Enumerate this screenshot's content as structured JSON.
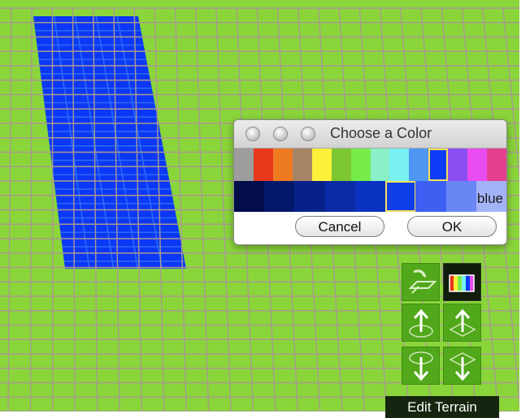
{
  "colors": {
    "terrain": "#8ad53a",
    "grid": "#a99a92",
    "painted_tiles": "#0c37f5",
    "tool_bg": "#50a81a",
    "tool_active_bg": "#121c0c",
    "label_bg": "#16250f"
  },
  "dialog": {
    "title": "Choose a Color",
    "window_buttons": [
      "close",
      "minimize",
      "zoom"
    ],
    "palette_hues": [
      {
        "name": "gray",
        "hex": "#9d9d9d"
      },
      {
        "name": "red",
        "hex": "#e8371b"
      },
      {
        "name": "orange",
        "hex": "#ee7a22"
      },
      {
        "name": "brown",
        "hex": "#a68466"
      },
      {
        "name": "yellow",
        "hex": "#fcf03a"
      },
      {
        "name": "green",
        "hex": "#7dc732"
      },
      {
        "name": "lime",
        "hex": "#76ec4a"
      },
      {
        "name": "turquoise",
        "hex": "#8af0c8"
      },
      {
        "name": "cyan",
        "hex": "#79f0f2"
      },
      {
        "name": "sky",
        "hex": "#4f97f2"
      },
      {
        "name": "blue",
        "hex": "#0c3cf5"
      },
      {
        "name": "violet",
        "hex": "#8a4ff2"
      },
      {
        "name": "magenta",
        "hex": "#e84cf0"
      },
      {
        "name": "pink",
        "hex": "#e5408e"
      }
    ],
    "selected_hue": "blue",
    "shades": [
      "#020d4a",
      "#04186b",
      "#06218a",
      "#0a2ba5",
      "#0b33c3",
      "#0d3ee8",
      "#3d60f3",
      "#6a85f4",
      "#a3b3f7"
    ],
    "selected_shade_index": 5,
    "selected_color_name": "blue",
    "cancel_label": "Cancel",
    "ok_label": "OK"
  },
  "tools": {
    "items": [
      {
        "name": "paint-tile",
        "icon": "paint-bucket-icon",
        "active": false
      },
      {
        "name": "color-picker",
        "icon": "color-spectrum-icon",
        "active": true
      },
      {
        "name": "raise-ground",
        "icon": "raise-circle-icon",
        "active": false
      },
      {
        "name": "raise-diamond",
        "icon": "raise-diamond-icon",
        "active": false
      },
      {
        "name": "lower-ground",
        "icon": "lower-circle-icon",
        "active": false
      },
      {
        "name": "lower-diamond",
        "icon": "lower-diamond-icon",
        "active": false
      }
    ],
    "panel_label": "Edit Terrain"
  }
}
